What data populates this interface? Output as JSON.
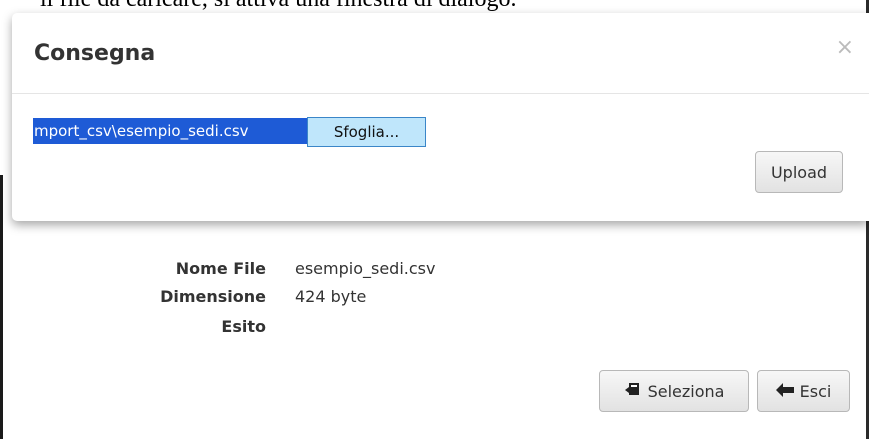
{
  "document": {
    "top_text": "il file da caricare, si attiva una finestra di dialogo."
  },
  "modal": {
    "title": "Consegna",
    "close_symbol": "×",
    "file_input": {
      "value": "mport_csv\\esempio_sedi.csv",
      "browse_label": "Sfoglia..."
    },
    "upload_label": "Upload"
  },
  "file_info": {
    "rows": [
      {
        "label": "Nome File",
        "value": "esempio_sedi.csv"
      },
      {
        "label": "Dimensione",
        "value": "424 byte"
      },
      {
        "label": "Esito",
        "value": ""
      }
    ]
  },
  "actions": {
    "select_label": "Seleziona",
    "select_icon": "select-file-icon",
    "exit_label": "Esci",
    "exit_icon": "arrow-left-icon"
  }
}
